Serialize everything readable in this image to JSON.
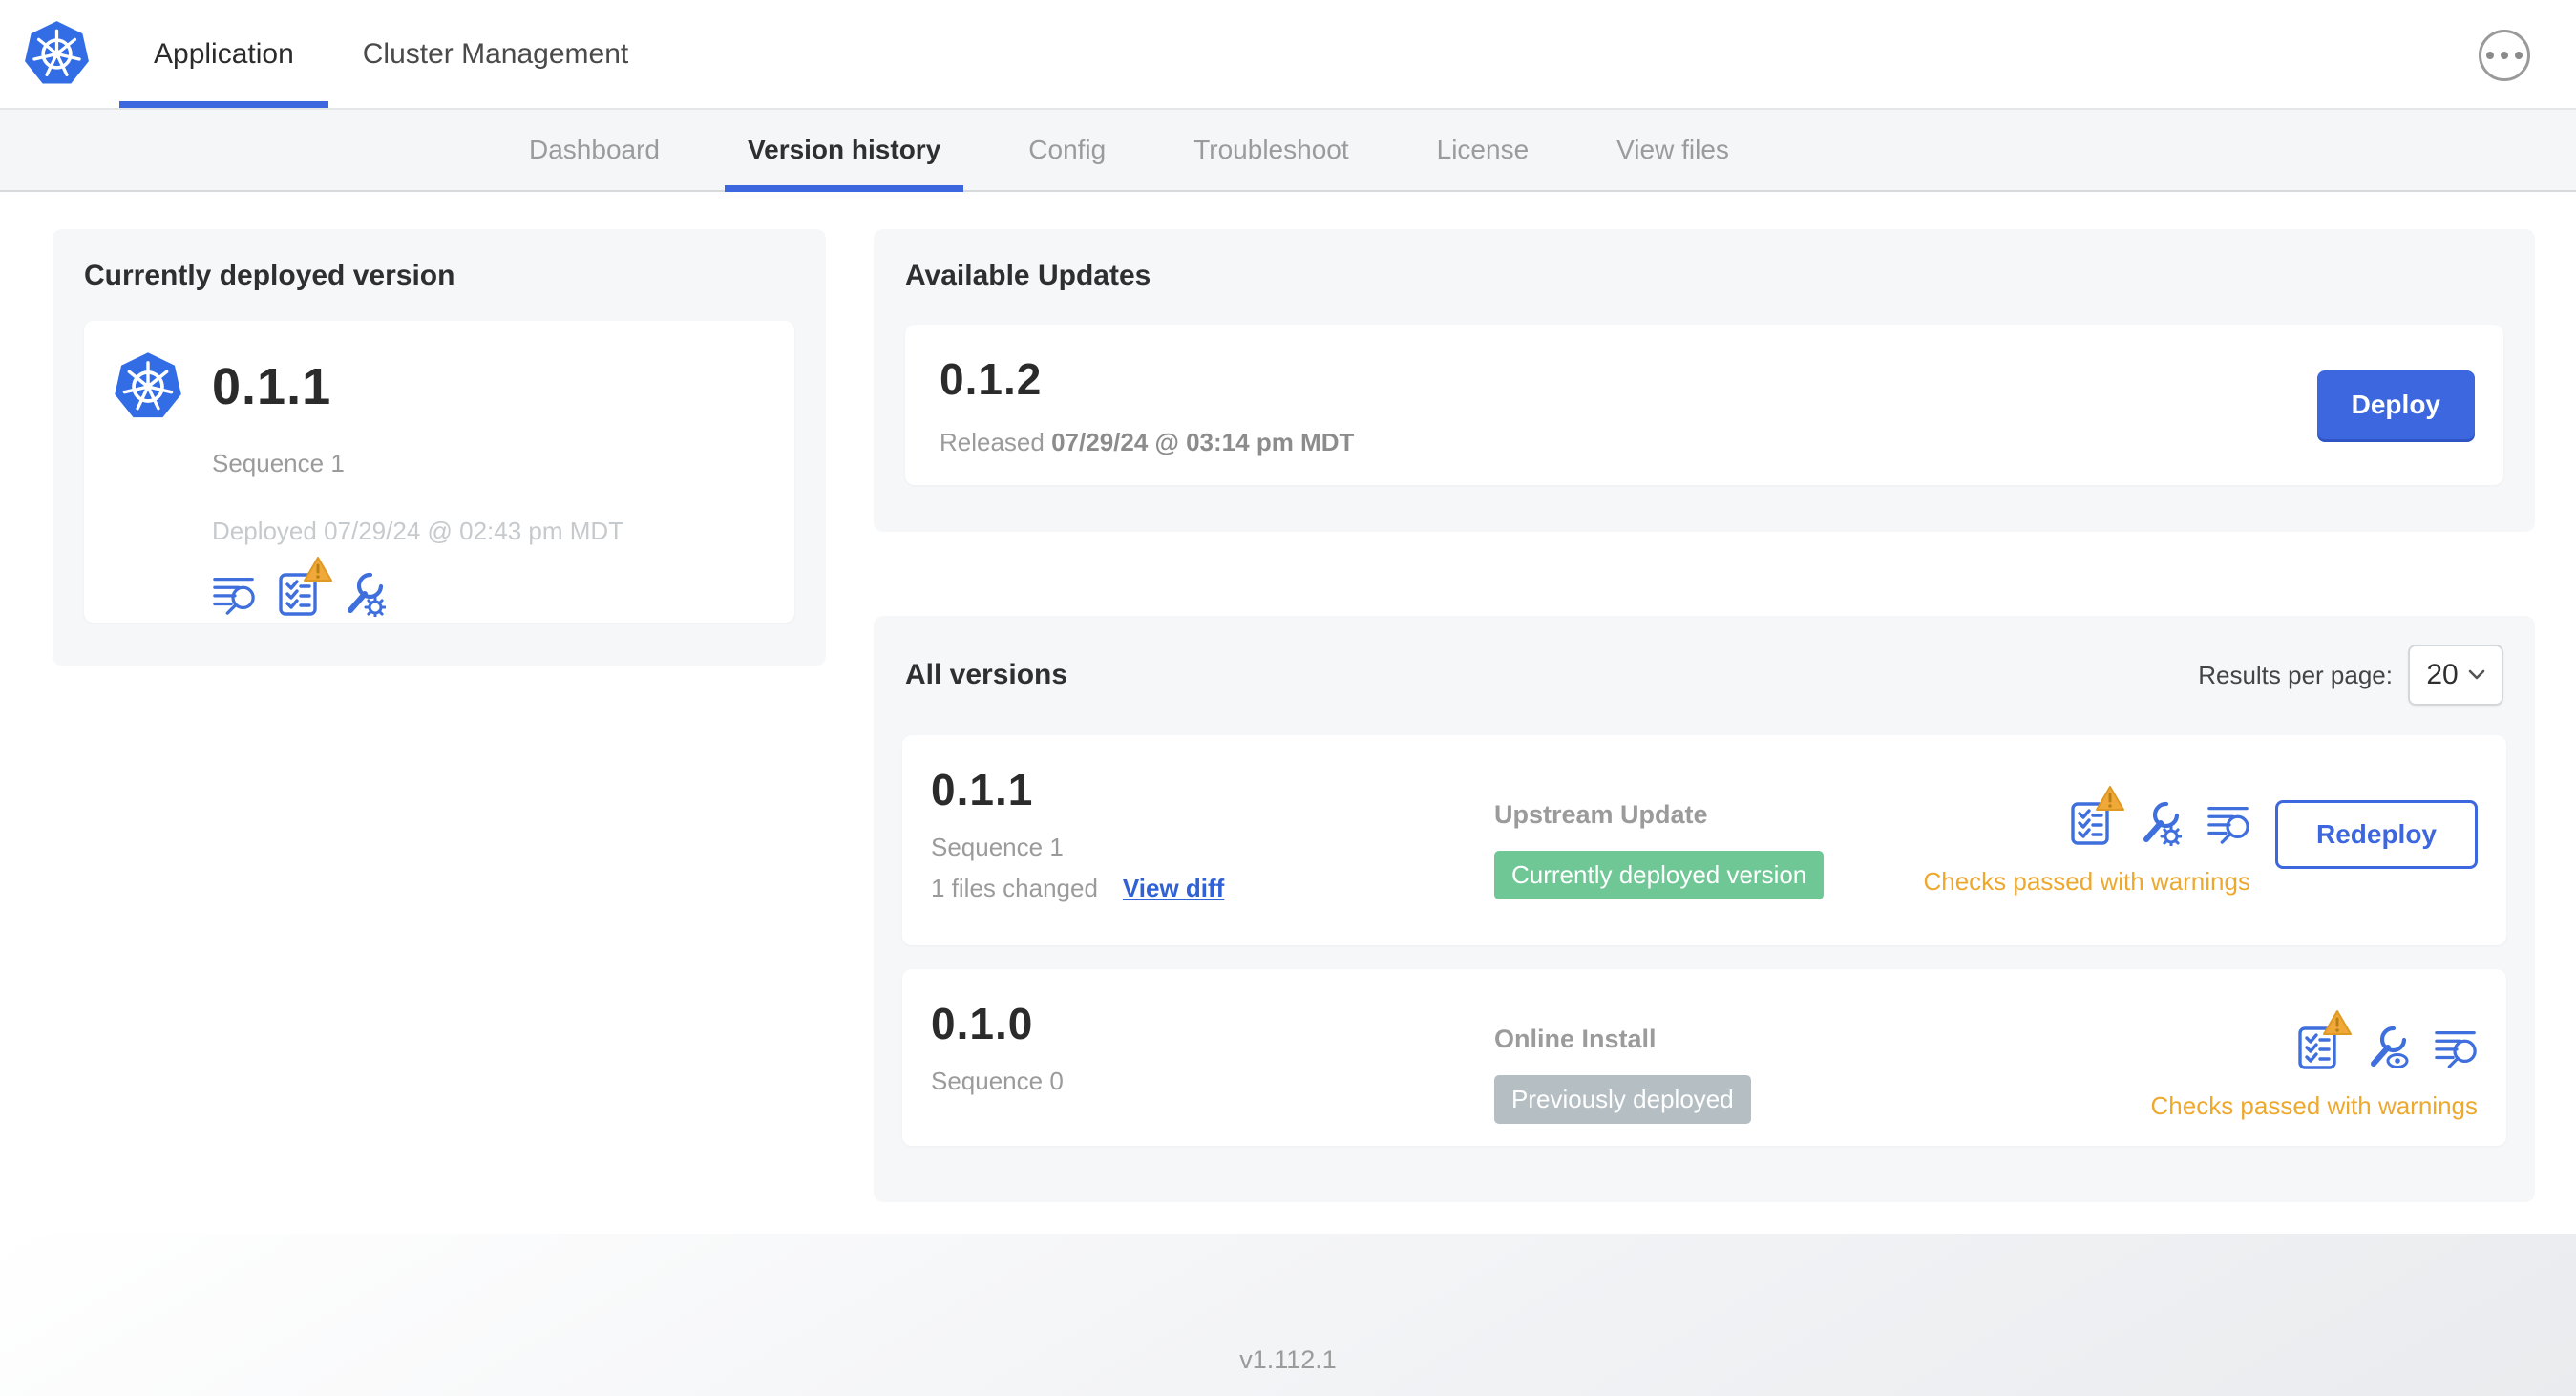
{
  "colors": {
    "accent_blue": "#3d67de",
    "logo_blue": "#326de6",
    "warning_amber": "#eda92e",
    "badge_green": "#6fc796",
    "badge_gray": "#b4bec3",
    "subnav_bg": "#f4f6f8",
    "card_bg": "#f5f7f9"
  },
  "icons": {
    "logo": "kubernetes-logo",
    "menu": "ellipsis-icon",
    "release_notes": "release-notes-search-icon",
    "preflight": "preflight-checklist-warning-icon",
    "config_gear": "wrench-gear-icon",
    "config_view": "wrench-eye-icon",
    "select_chevron": "chevron-down-icon"
  },
  "header": {
    "tabs": [
      {
        "label": "Application",
        "active": true
      },
      {
        "label": "Cluster Management",
        "active": false
      }
    ]
  },
  "subnav": {
    "items": [
      {
        "label": "Dashboard",
        "active": false
      },
      {
        "label": "Version history",
        "active": true
      },
      {
        "label": "Config",
        "active": false
      },
      {
        "label": "Troubleshoot",
        "active": false
      },
      {
        "label": "License",
        "active": false
      },
      {
        "label": "View files",
        "active": false
      }
    ]
  },
  "current_version_card": {
    "title": "Currently deployed version",
    "version": "0.1.1",
    "sequence": "Sequence 1",
    "deployed": "Deployed 07/29/24 @ 02:43 pm MDT"
  },
  "available_updates": {
    "title": "Available Updates",
    "version": "0.1.2",
    "released_prefix": "Released",
    "released_date": "07/29/24 @ 03:14 pm MDT",
    "deploy_label": "Deploy"
  },
  "all_versions": {
    "title": "All versions",
    "results_per_page_label": "Results per page:",
    "results_per_page_value": "20",
    "rows": [
      {
        "version": "0.1.1",
        "sequence": "Sequence 1",
        "files_changed": "1 files changed",
        "view_diff_label": "View diff",
        "source": "Upstream Update",
        "badge": "Currently deployed version",
        "badge_color": "green",
        "action_label": "Redeploy",
        "status": "Checks passed with warnings"
      },
      {
        "version": "0.1.0",
        "sequence": "Sequence 0",
        "source": "Online Install",
        "badge": "Previously deployed",
        "badge_color": "gray",
        "status": "Checks passed with warnings"
      }
    ]
  },
  "footer": {
    "app_version": "v1.112.1"
  }
}
